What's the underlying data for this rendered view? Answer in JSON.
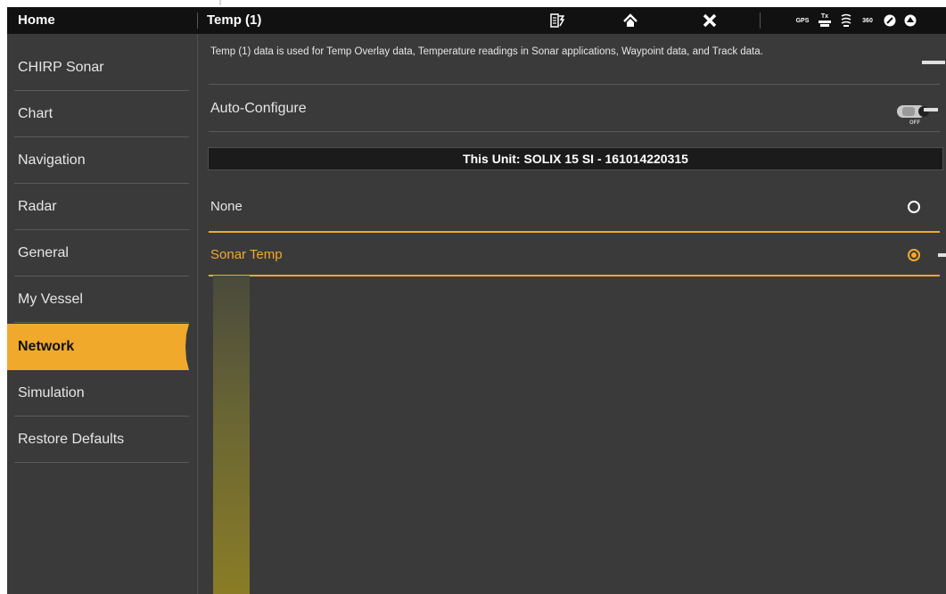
{
  "header": {
    "home_label": "Home",
    "title": "Temp (1)",
    "icons": [
      "menu-exit-icon",
      "home-icon",
      "close-icon"
    ],
    "status": {
      "gps_label": "GPS",
      "tx_label": "Tx",
      "sonar360_label": "360",
      "icons": [
        "gps-status-icon",
        "transmit-status-icon",
        "sonar-status-icon",
        "sonar-360-status-icon",
        "radar-status-icon",
        "autopilot-status-icon"
      ]
    }
  },
  "sidebar": {
    "items": [
      {
        "label": "CHIRP Sonar",
        "active": false
      },
      {
        "label": "Chart",
        "active": false
      },
      {
        "label": "Navigation",
        "active": false
      },
      {
        "label": "Radar",
        "active": false
      },
      {
        "label": "General",
        "active": false
      },
      {
        "label": "My Vessel",
        "active": false
      },
      {
        "label": "Network",
        "active": true
      },
      {
        "label": "Simulation",
        "active": false
      },
      {
        "label": "Restore Defaults",
        "active": false
      }
    ]
  },
  "main": {
    "description": "Temp (1) data is used for Temp Overlay data, Temperature readings in Sonar applications, Waypoint data, and Track data.",
    "auto_configure": {
      "label": "Auto-Configure",
      "state": "OFF"
    },
    "unit_header": "This Unit: SOLIX 15 SI - 161014220315",
    "options": [
      {
        "label": "None",
        "selected": false
      },
      {
        "label": "Sonar Temp",
        "selected": true
      }
    ]
  },
  "colors": {
    "accent": "#f0a92a",
    "background": "#3a3a3a",
    "titlebar": "#111111",
    "text": "#e6e6e6"
  }
}
